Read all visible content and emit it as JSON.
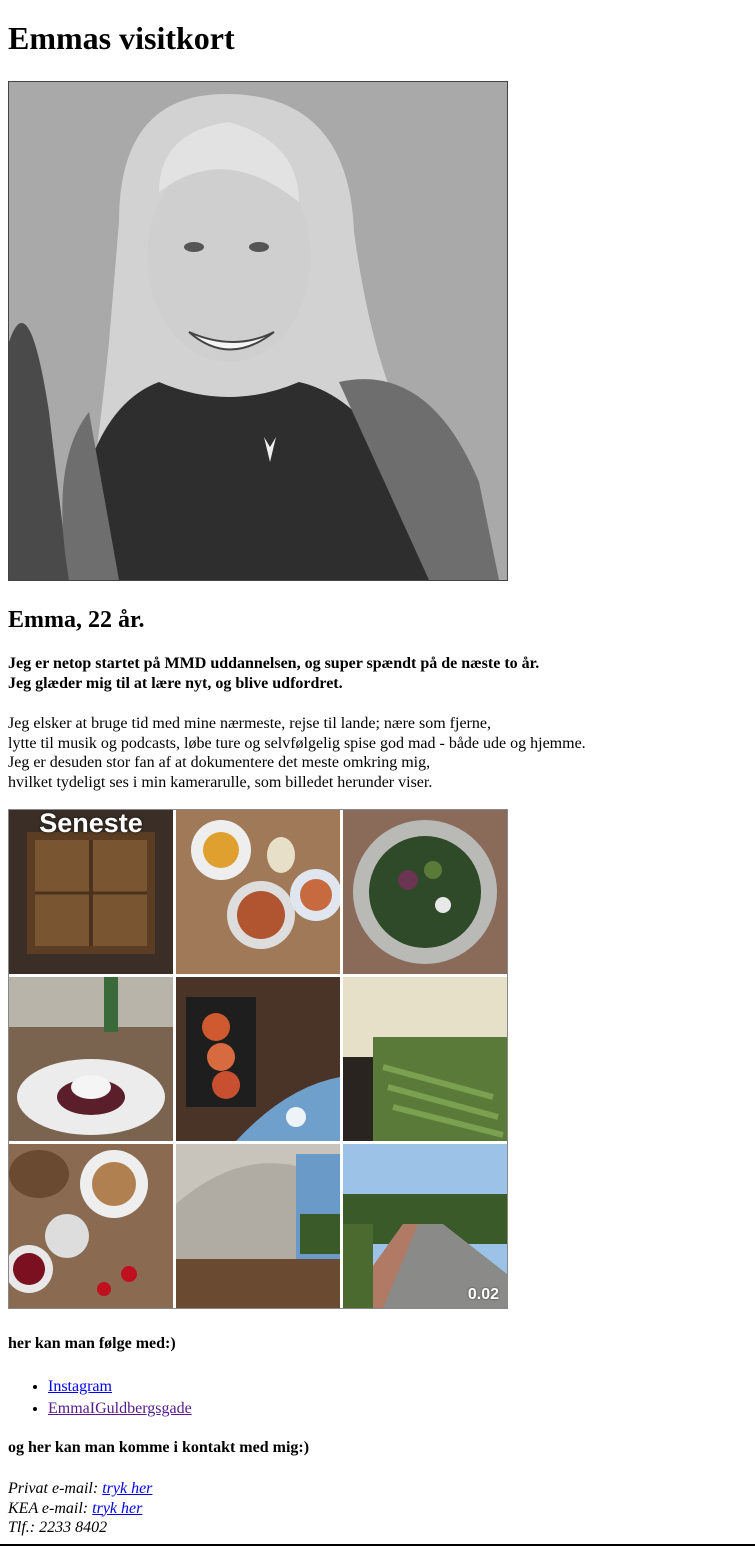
{
  "page": {
    "title": "Emmas visitkort"
  },
  "profile": {
    "name_age": "Emma, 22 år.",
    "intro_lines": [
      "Jeg er netop startet på MMD uddannelsen, og super spændt på de næste to år.",
      "Jeg glæder mig til at lære nyt, og blive udfordret."
    ],
    "about_lines": [
      "Jeg elsker at bruge tid med mine nærmeste, rejse til lande; nære som fjerne,",
      "lytte til musik og podcasts, løbe ture og selvfølgelig spise god mad - både ude og hjemme.",
      "Jeg er desuden stor fan af at dokumentere det meste omkring mig,",
      "hvilket tydeligt ses i min kamerarulle, som billedet herunder viser."
    ]
  },
  "camera_roll": {
    "album_label": "Seneste",
    "video_duration": "0.02"
  },
  "follow": {
    "heading": "her kan man følge med:)",
    "links": [
      {
        "label": "Instagram",
        "visited": false
      },
      {
        "label": "EmmaIGuldbergsgade",
        "visited": true
      }
    ]
  },
  "contact": {
    "heading": "og her kan man komme i kontakt med mig:)",
    "private_email_label": "Privat e-mail:",
    "private_email_link": "tryk her",
    "kea_email_label": "KEA e-mail:",
    "kea_email_link": "tryk her",
    "phone": "Tlf.: 2233 8402"
  },
  "colors": {
    "link": "#0000ee",
    "visited_link": "#551a8b"
  }
}
